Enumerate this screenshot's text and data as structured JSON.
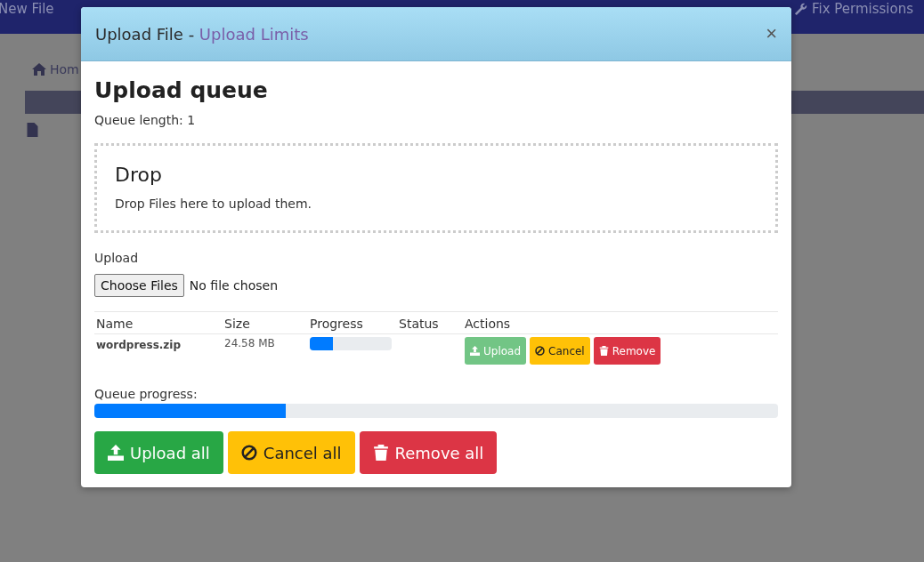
{
  "toolbar": [
    {
      "label": "New File"
    },
    {
      "label": "Fix Permissions"
    }
  ],
  "breadcrumb": {
    "label": "Hom"
  },
  "modal": {
    "title": "Upload File - ",
    "title_link": "Upload Limits",
    "close": "×",
    "heading": "Upload queue",
    "queue_length": "Queue length: 1",
    "drop_zone": {
      "title": "Drop",
      "text": "Drop Files here to upload them."
    },
    "upload_label": "Upload",
    "file_button": "Choose Files",
    "file_status": "No file chosen",
    "table": {
      "columns": [
        "Name",
        "Size",
        "Progress",
        "Status",
        "Actions"
      ],
      "rows": [
        {
          "name": "wordpress.zip",
          "size": "24.58 MB",
          "level": 0.28,
          "actions": [
            {
              "label": "Upload",
              "kind": "upload",
              "disabled": true
            },
            {
              "label": "Cancel",
              "kind": "cancel",
              "disabled": false
            },
            {
              "label": "Remove",
              "kind": "remove",
              "disabled": false
            }
          ]
        }
      ]
    },
    "queue_progress": {
      "label": "Queue progress:",
      "level": 0.28
    },
    "buttons": [
      {
        "label": "Upload all",
        "kind": "upload"
      },
      {
        "label": "Cancel all",
        "kind": "cancel"
      },
      {
        "label": "Remove all",
        "kind": "remove"
      }
    ]
  }
}
